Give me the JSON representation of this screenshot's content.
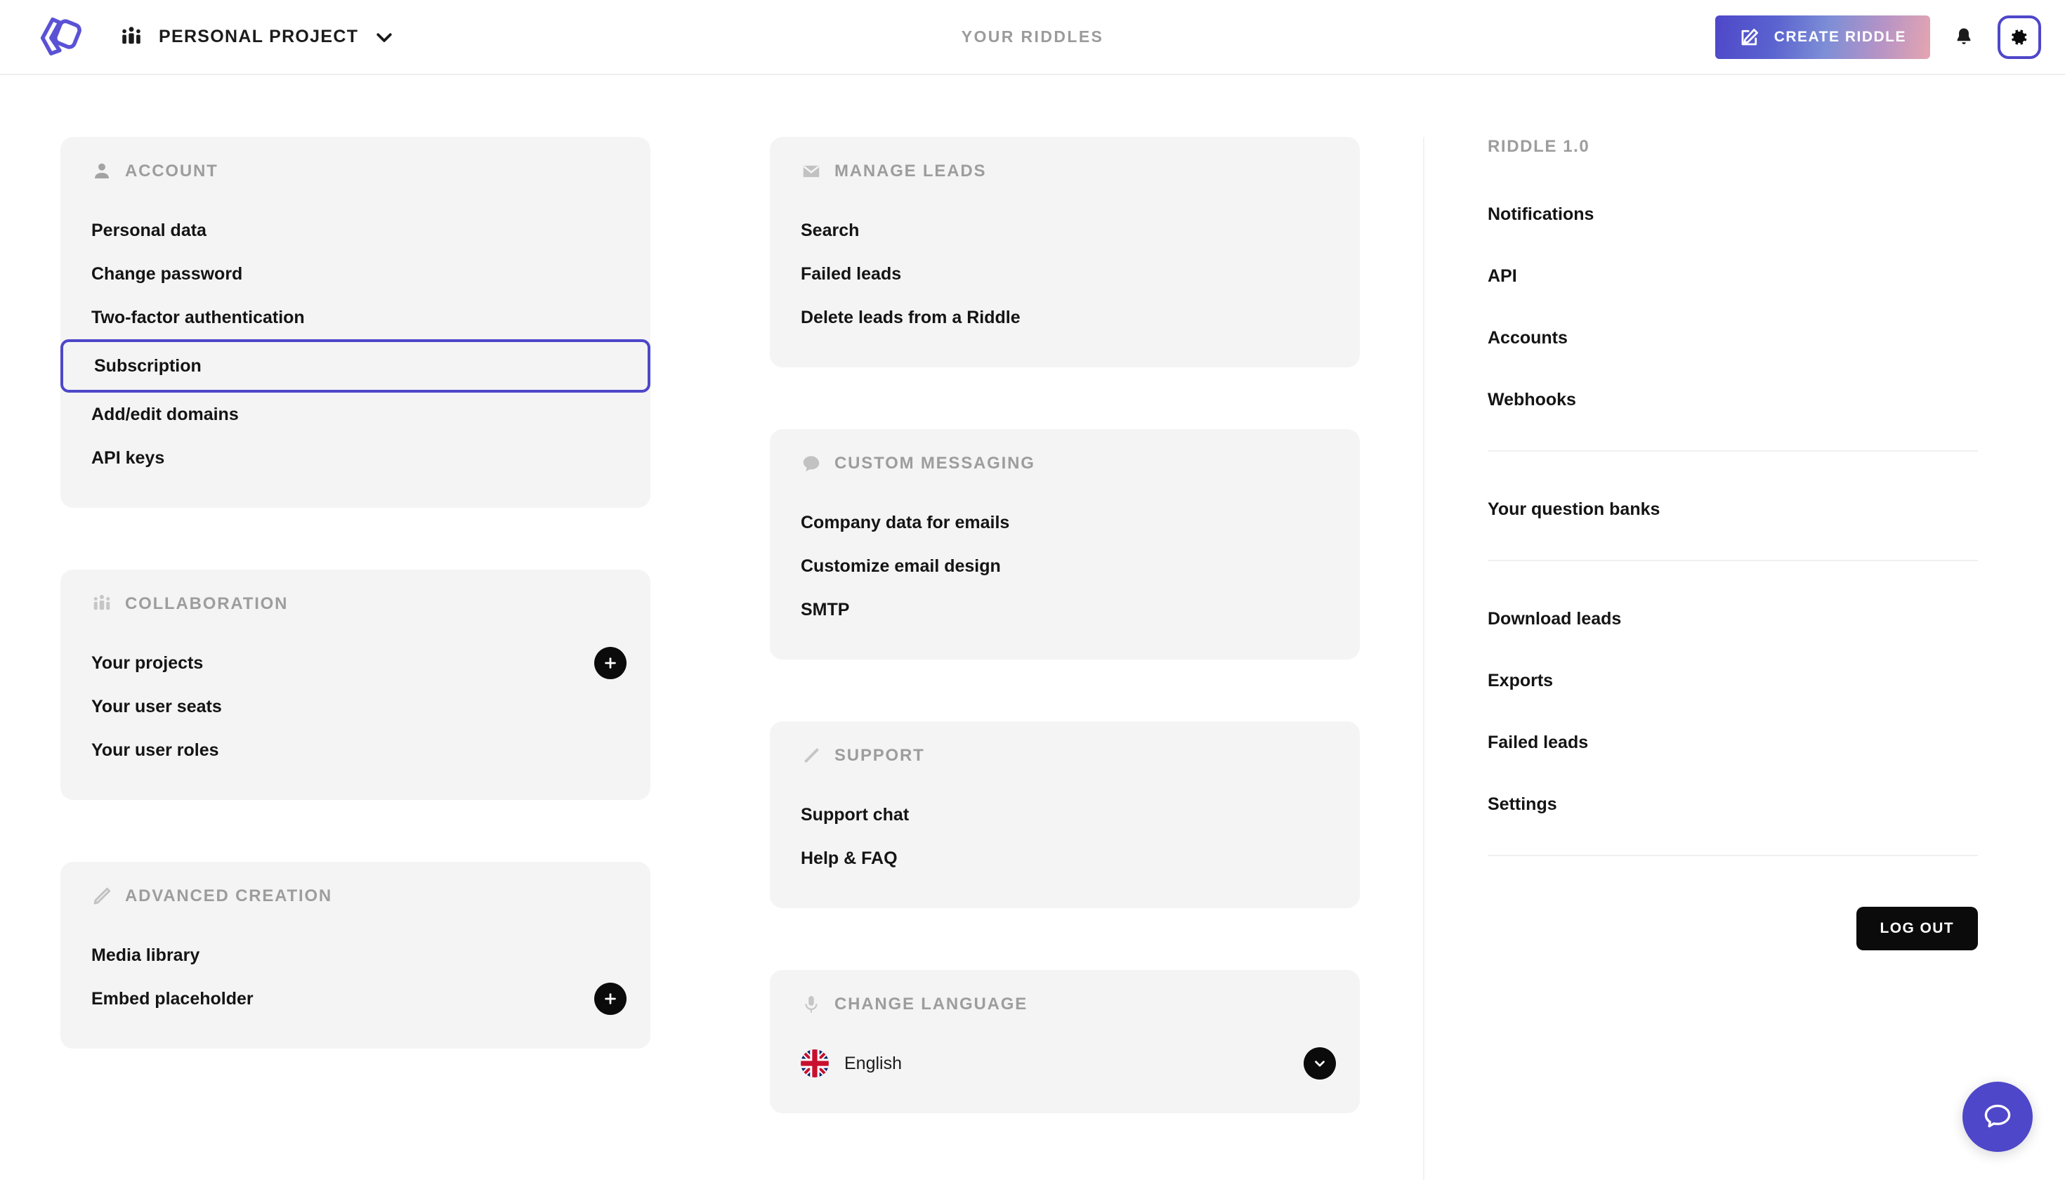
{
  "header": {
    "logo_icon": "riddle-logo",
    "project_icon": "group-people-icon",
    "project_name": "PERSONAL PROJECT",
    "project_chevron_icon": "chevron-down-icon",
    "center_title": "YOUR RIDDLES",
    "create_riddle_label": "CREATE RIDDLE",
    "create_riddle_icon": "pencil-square-icon",
    "notifications_icon": "bell-icon",
    "settings_icon": "gear-icon",
    "accent_color": "#4e47c9"
  },
  "left_column": {
    "cards": [
      {
        "icon": "person-icon",
        "title": "ACCOUNT",
        "items": [
          {
            "label": "Personal data",
            "highlight": false,
            "action": null
          },
          {
            "label": "Change password",
            "highlight": false,
            "action": null
          },
          {
            "label": "Two-factor authentication",
            "highlight": false,
            "action": null
          },
          {
            "label": "Subscription",
            "highlight": true,
            "action": null
          },
          {
            "label": "Add/edit domains",
            "highlight": false,
            "action": null
          },
          {
            "label": "API keys",
            "highlight": false,
            "action": null
          }
        ]
      },
      {
        "icon": "group-people-icon",
        "title": "COLLABORATION",
        "items": [
          {
            "label": "Your projects",
            "highlight": false,
            "action": "add"
          },
          {
            "label": "Your user seats",
            "highlight": false,
            "action": null
          },
          {
            "label": "Your user roles",
            "highlight": false,
            "action": null
          }
        ]
      },
      {
        "icon": "pencil-icon",
        "title": "ADVANCED CREATION",
        "items": [
          {
            "label": "Media library",
            "highlight": false,
            "action": null
          },
          {
            "label": "Embed placeholder",
            "highlight": false,
            "action": "add"
          }
        ]
      }
    ]
  },
  "mid_column": {
    "cards": [
      {
        "icon": "envelope-icon",
        "title": "MANAGE LEADS",
        "items": [
          {
            "label": "Search",
            "highlight": false,
            "action": null
          },
          {
            "label": "Failed leads",
            "highlight": false,
            "action": null
          },
          {
            "label": "Delete leads from a Riddle",
            "highlight": false,
            "action": null
          }
        ]
      },
      {
        "icon": "speech-bubble-icon",
        "title": "CUSTOM MESSAGING",
        "items": [
          {
            "label": "Company data for emails",
            "highlight": false,
            "action": null
          },
          {
            "label": "Customize email design",
            "highlight": false,
            "action": null
          },
          {
            "label": "SMTP",
            "highlight": false,
            "action": null
          }
        ]
      },
      {
        "icon": "wrench-icon",
        "title": "SUPPORT",
        "items": [
          {
            "label": "Support chat",
            "highlight": false,
            "action": null
          },
          {
            "label": "Help & FAQ",
            "highlight": false,
            "action": null
          }
        ]
      }
    ],
    "language_card": {
      "icon": "microphone-icon",
      "title": "CHANGE LANGUAGE",
      "selected_language": "English",
      "flag_icon": "uk-flag-icon",
      "caret_icon": "chevron-down-icon"
    }
  },
  "right_column": {
    "title": "RIDDLE 1.0",
    "group_one": [
      {
        "label": "Notifications"
      },
      {
        "label": "API"
      },
      {
        "label": "Accounts"
      },
      {
        "label": "Webhooks"
      }
    ],
    "group_two": [
      {
        "label": "Your question banks"
      }
    ],
    "group_three": [
      {
        "label": "Download leads"
      },
      {
        "label": "Exports"
      },
      {
        "label": "Failed leads"
      },
      {
        "label": "Settings"
      }
    ],
    "logout_label": "LOG OUT"
  },
  "chat_fab": {
    "icon": "chat-bubble-icon",
    "color": "#4e47c9"
  }
}
